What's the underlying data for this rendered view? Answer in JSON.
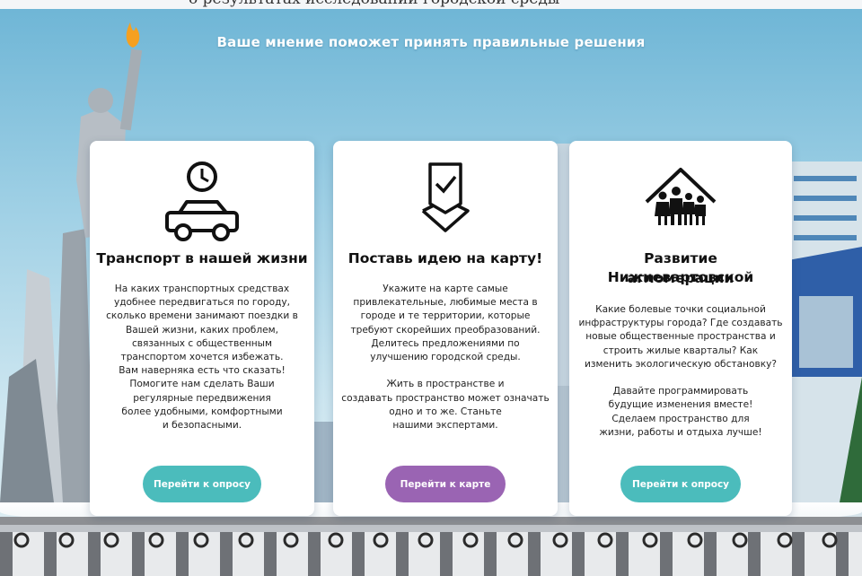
{
  "top_banner": {
    "text": "о результатах исследований городской среды"
  },
  "headline": "Ваше мнение поможет принять правильные решения",
  "cards": [
    {
      "icon": "clock-car-icon",
      "title": "Транспорт в нашей жизни",
      "text": "На каких транспортных средствах\nудобнее передвигаться по городу,\nсколько времени занимают поездки в\nВашей жизни, каких проблем,\nсвязанных с общественным\nтранспортом хочется избежать.\nВам наверняка есть что сказать!\nПомогите нам сделать Ваши\nрегулярные передвижения\nболее удобными, комфортными\nи безопасными.",
      "button": "Перейти к опросу"
    },
    {
      "icon": "map-pin-check-icon",
      "title": "Поставь идею на карту!",
      "text": "Укажите на карте самые\nпривлекательные, любимые места в\nгороде и те территории, которые\nтребуют скорейших преобразований.\nДелитесь предложениями по\nулучшению городской среды.\n\nЖить в пространстве и\nсоздавать пространство может означать\nодно и то же. Станьте\nнашими экспертами.",
      "button": "Перейти к карте"
    },
    {
      "icon": "family-house-icon",
      "title_line1": "Развитие Нижневартовской",
      "title_line2": "агломерации",
      "text": "Какие болевые точки социальной\nинфраструктуры города? Где создавать\nновые общественные пространства и\nстроить жилые кварталы? Как\nизменить экологическую обстановку?\n\nДавайте программировать\nбудущие изменения вместе!\nСделаем пространство для\nжизни, работы и отдыха лучше!",
      "button": "Перейти к опросу"
    }
  ],
  "colors": {
    "teal_button": "#4bbcbc",
    "purple_button": "#9a64b3",
    "sky": "#9fd0e5"
  }
}
